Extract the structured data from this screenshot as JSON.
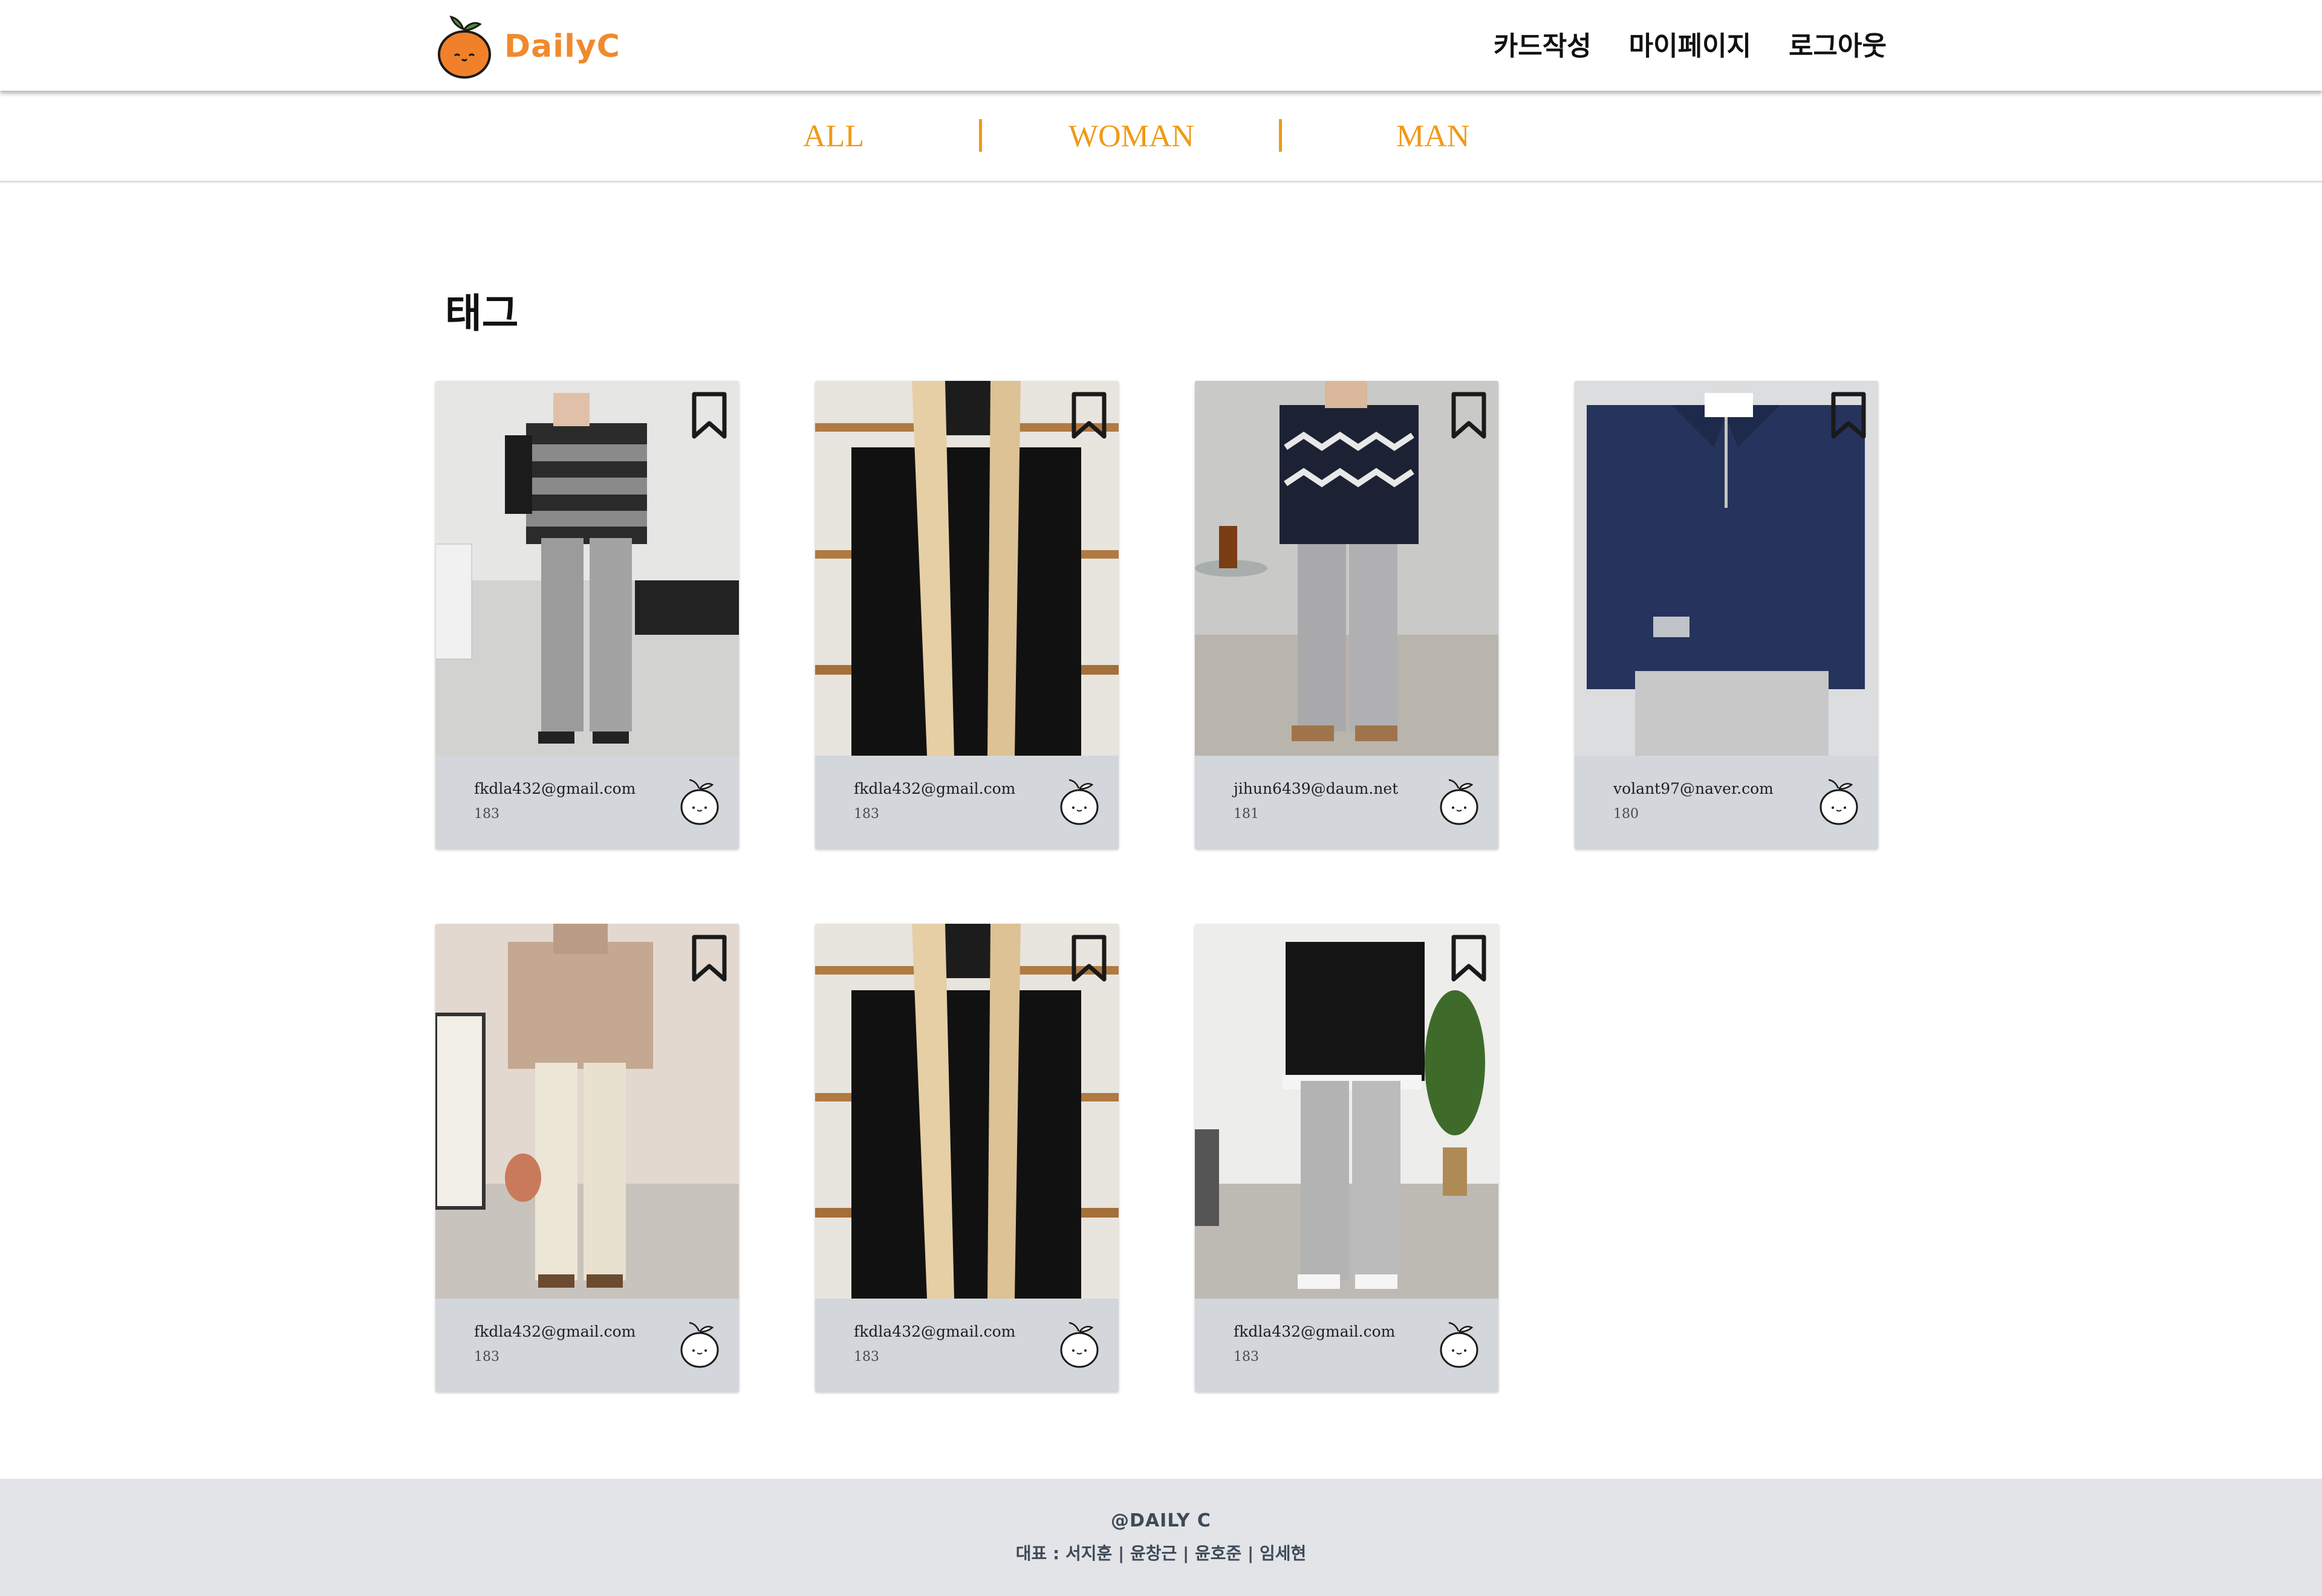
{
  "header": {
    "logo_text": "DailyC",
    "nav": [
      "카드작성",
      "마이페이지",
      "로그아웃"
    ]
  },
  "categories": [
    "ALL",
    "WOMAN",
    "MAN"
  ],
  "page_title": "태그",
  "colors": {
    "accent": "#ef9a17",
    "logo": "#f08a2c",
    "card_bg": "#d3d6db",
    "footer_bg": "#e2e4e8"
  },
  "icons": {
    "bookmark": "bookmark-icon",
    "like": "tangerine-face-icon",
    "logo": "tangerine-logo-icon"
  },
  "cards": [
    {
      "email": "fkdla432@gmail.com",
      "height": "183"
    },
    {
      "email": "fkdla432@gmail.com",
      "height": "183"
    },
    {
      "email": "jihun6439@daum.net",
      "height": "181"
    },
    {
      "email": "volant97@naver.com",
      "height": "180"
    },
    {
      "email": "fkdla432@gmail.com",
      "height": "183"
    },
    {
      "email": "fkdla432@gmail.com",
      "height": "183"
    },
    {
      "email": "fkdla432@gmail.com",
      "height": "183"
    }
  ],
  "footer": {
    "brand": "@DAILY C",
    "representatives": "대표 : 서지훈 | 윤창근 | 윤호준 | 임세현"
  }
}
